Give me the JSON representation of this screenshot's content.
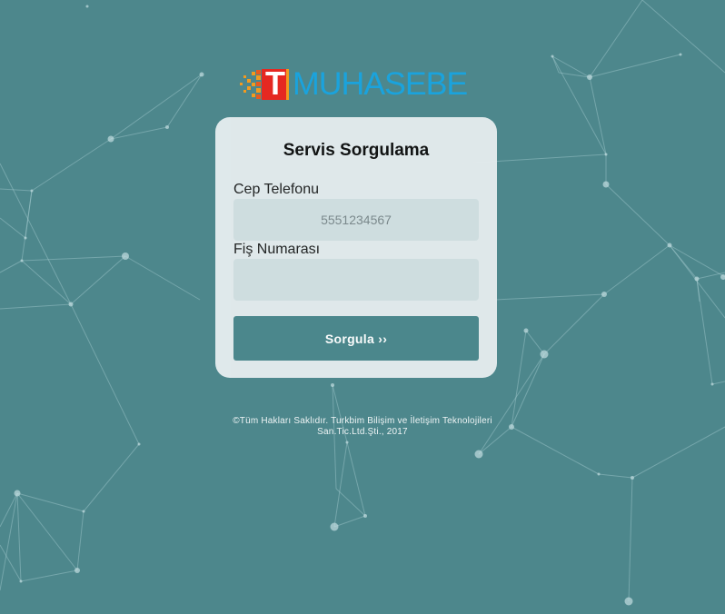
{
  "brand": {
    "logo_letter": "T",
    "logo_text": "MUHASEBE"
  },
  "form": {
    "title": "Servis Sorgulama",
    "phone_label": "Cep Telefonu",
    "phone_placeholder": "5551234567",
    "receipt_label": "Fiş Numarası",
    "receipt_placeholder": "",
    "submit_label": "Sorgula ››"
  },
  "footer": {
    "line1": "©Tüm Hakları Saklıdır. Turkbim Bilişim ve İletişim Teknolojileri",
    "line2": "San.Tic.Ltd.Şti., 2017"
  },
  "colors": {
    "background": "#4d878c",
    "card": "#e4ecee",
    "input": "#d3e0e2",
    "button": "#4b878c",
    "logo_blue": "#1aa3dd",
    "logo_red": "#e52821",
    "logo_orange": "#f39a1e"
  }
}
